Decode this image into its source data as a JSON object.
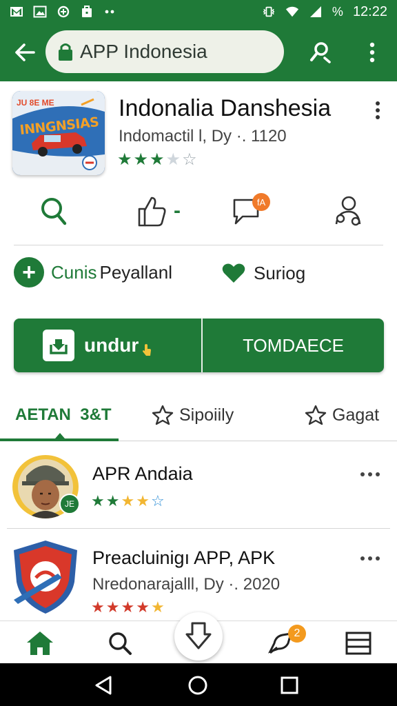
{
  "status_bar": {
    "time": "12:22",
    "battery_text": "%",
    "icons": [
      "gmail-icon",
      "image-icon",
      "data-saver-icon",
      "briefcase-icon",
      "more-dots-icon",
      "vibrate-icon",
      "wifi-icon",
      "signal-icon"
    ]
  },
  "app_bar": {
    "url": "APP Indonesia",
    "icons": [
      "back-arrow-icon",
      "lock-icon",
      "search-icon",
      "more-vert-icon"
    ]
  },
  "app": {
    "icon_text": "INNGNSIAS",
    "icon_top_text": "JU 8E ME",
    "title": "Indonalia Danshesia",
    "subtitle": "Indomactil l, Dy ·. 1120",
    "rating": 3.5,
    "stars_filled": 3,
    "stars_total": 5
  },
  "actions": {
    "like_label": "-",
    "comment_badge": "fA",
    "icons": [
      "search-icon",
      "thumbs-up-icon",
      "comment-icon",
      "share-person-icon"
    ]
  },
  "follow": {
    "label_green": "Cunis",
    "label_dark": "Peyallanl"
  },
  "favorite": {
    "label": "Suriog"
  },
  "buttons": {
    "primary": "undur",
    "secondary": "TOMDAECE"
  },
  "tabs": [
    {
      "label": "AETAN  3&T",
      "active": true
    },
    {
      "label": "Sipoiily",
      "active": false
    },
    {
      "label": "Gagat",
      "active": false
    }
  ],
  "list": [
    {
      "title": "APR Andaia",
      "badge": "JE",
      "stars_filled": 4,
      "stars_total": 5
    },
    {
      "title": "Preacluinigı APP, APK",
      "subtitle": "Nredonarajalll, Dy ·. 2020",
      "stars_filled": 4,
      "stars_total": 5
    }
  ],
  "bottom_nav": {
    "badge": "2",
    "icons": [
      "home-icon",
      "search-icon",
      "download-icon",
      "chat-icon",
      "menu-icon"
    ]
  },
  "colors": {
    "primary": "#1f7a38",
    "accent_orange": "#f39a1e",
    "star_red": "#d23a2a",
    "star_gold": "#f2b632"
  }
}
